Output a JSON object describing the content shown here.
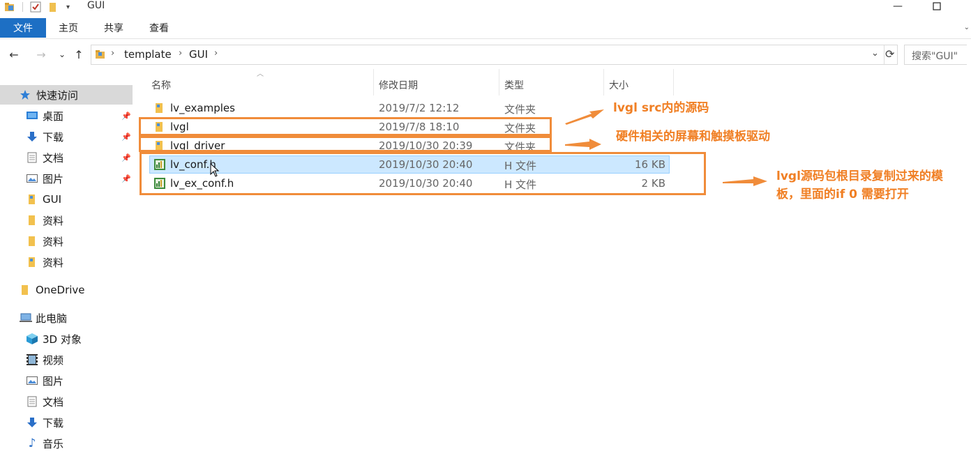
{
  "window": {
    "title": "GUI",
    "buttons": {
      "minimize": "—",
      "maximize": "☐"
    }
  },
  "ribbon": {
    "tabs": [
      "文件",
      "主页",
      "共享",
      "查看"
    ]
  },
  "nav": {
    "back": "←",
    "forward": "→",
    "recent": "⌄",
    "up": "↑",
    "breadcrumbs": [
      "template",
      "GUI"
    ],
    "dropdown": "⌄",
    "refresh": "⟳"
  },
  "search": {
    "placeholder": "搜索\"GUI\""
  },
  "sidebar": {
    "quick_access": "快速访问",
    "items": [
      {
        "label": "桌面",
        "icon": "desktop-icon",
        "pinned": true
      },
      {
        "label": "下载",
        "icon": "download-icon",
        "pinned": true
      },
      {
        "label": "文档",
        "icon": "document-icon",
        "pinned": true
      },
      {
        "label": "图片",
        "icon": "pictures-icon",
        "pinned": true
      },
      {
        "label": "GUI",
        "icon": "folder-icon",
        "pinned": false
      },
      {
        "label": "资料",
        "icon": "folder-icon",
        "pinned": false
      },
      {
        "label": "资料",
        "icon": "folder-icon",
        "pinned": false
      },
      {
        "label": "资料",
        "icon": "folder-icon",
        "pinned": false
      }
    ],
    "onedrive": "OneDrive",
    "this_pc": "此电脑",
    "pc_items": [
      {
        "label": "3D 对象",
        "icon": "3d-objects-icon"
      },
      {
        "label": "视频",
        "icon": "videos-icon"
      },
      {
        "label": "图片",
        "icon": "pictures-icon"
      },
      {
        "label": "文档",
        "icon": "document-icon"
      },
      {
        "label": "下载",
        "icon": "download-icon"
      },
      {
        "label": "音乐",
        "icon": "music-icon"
      }
    ]
  },
  "columns": {
    "name": "名称",
    "date": "修改日期",
    "type": "类型",
    "size": "大小"
  },
  "files": [
    {
      "name": "lv_examples",
      "date": "2019/7/2 12:12",
      "type": "文件夹",
      "size": "",
      "icon": "folder-icon",
      "selected": false
    },
    {
      "name": "lvgl",
      "date": "2019/7/8 18:10",
      "type": "文件夹",
      "size": "",
      "icon": "folder-icon",
      "selected": false
    },
    {
      "name": "lvgl_driver",
      "date": "2019/10/30 20:39",
      "type": "文件夹",
      "size": "",
      "icon": "folder-icon",
      "selected": false
    },
    {
      "name": "lv_conf.h",
      "date": "2019/10/30 20:40",
      "type": "H 文件",
      "size": "16 KB",
      "icon": "header-file-icon",
      "selected": true
    },
    {
      "name": "lv_ex_conf.h",
      "date": "2019/10/30 20:40",
      "type": "H 文件",
      "size": "2 KB",
      "icon": "header-file-icon",
      "selected": false
    }
  ],
  "annotations": {
    "note1": "lvgl src内的源码",
    "note2": "硬件相关的屏幕和触摸板驱动",
    "note3_line1": "lvgl源码包根目录复制过来的模",
    "note3_line2": "板，里面的if 0 需要打开",
    "color": "#f08c3a"
  },
  "colors": {
    "accent": "#1d6fc4",
    "selection": "#cce8ff",
    "annotation": "#f07f24"
  }
}
